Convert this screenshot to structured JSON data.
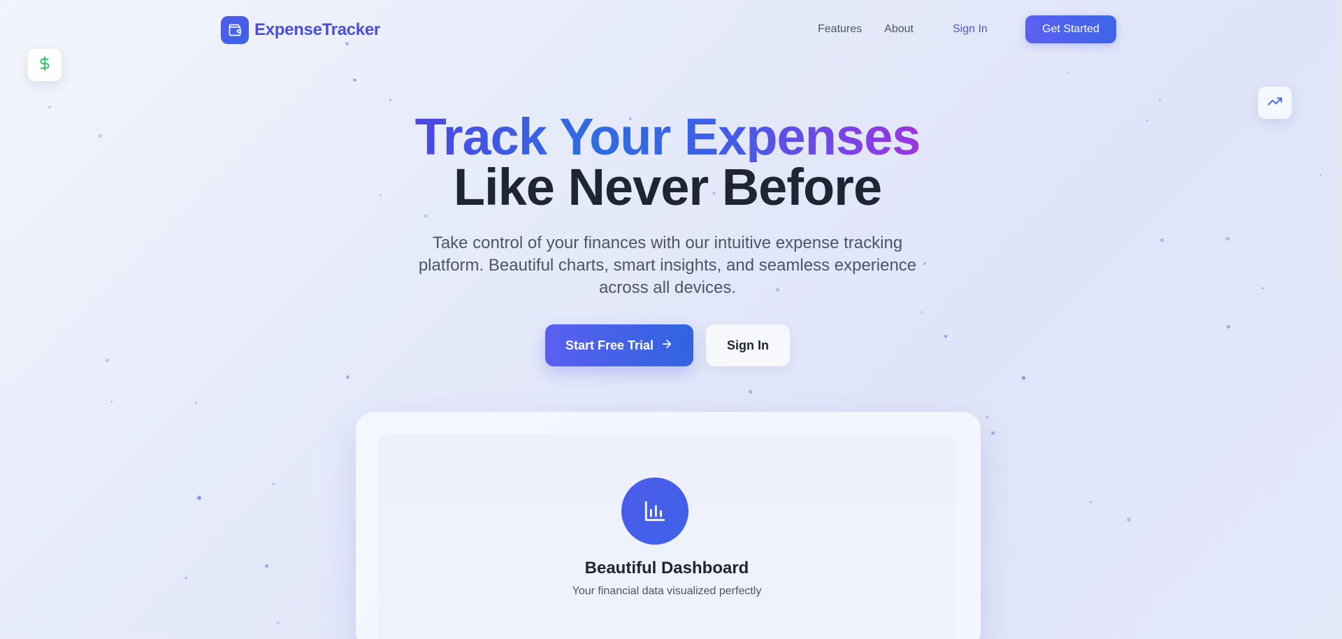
{
  "brand": {
    "name": "ExpenseTracker",
    "logo_icon": "wallet-icon"
  },
  "nav": {
    "links": [
      "Features",
      "About"
    ],
    "sign_in": "Sign In",
    "get_started": "Get Started"
  },
  "floating_badges": {
    "left_icon": "dollar-icon",
    "right_icon": "trending-up-icon"
  },
  "hero": {
    "title_line1": "Track Your Expenses",
    "title_line2": "Like Never Before",
    "subtitle": "Take control of your finances with our intuitive expense tracking platform. Beautiful charts, smart insights, and seamless experience across all devices.",
    "primary_cta": "Start Free Trial",
    "secondary_cta": "Sign In"
  },
  "preview": {
    "icon": "bar-chart-icon",
    "title": "Beautiful Dashboard",
    "subtitle": "Your financial data visualized perfectly"
  },
  "colors": {
    "accent": "#4f5bea",
    "accent_blue": "#2f64e0",
    "gradient_purple": "#9b35e0",
    "dollar_green": "#22c55e"
  }
}
